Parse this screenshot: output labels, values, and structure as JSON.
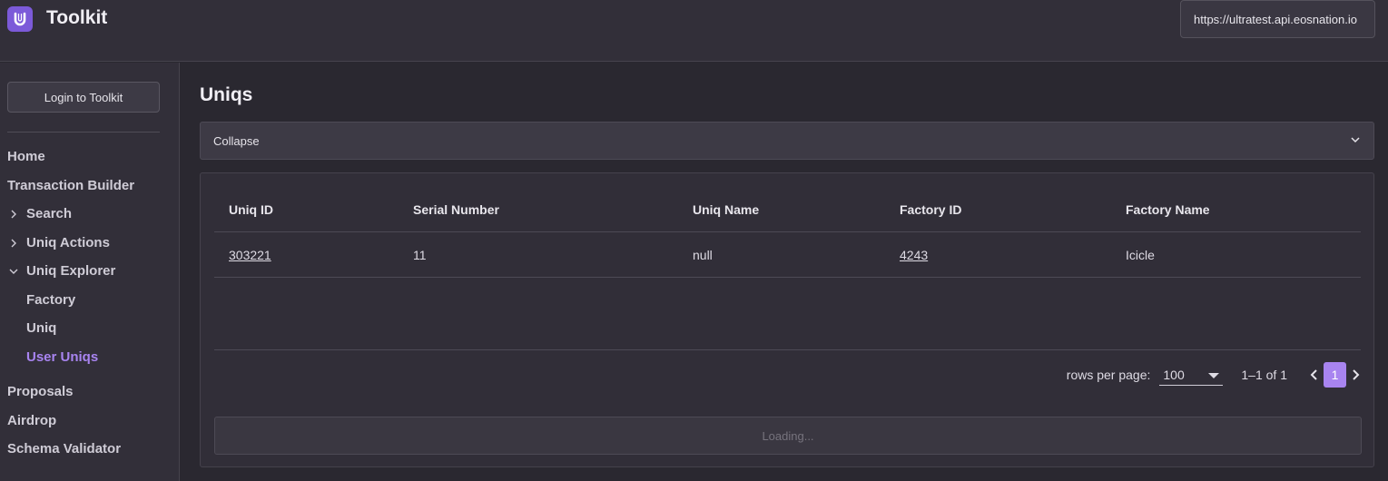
{
  "header": {
    "app_title": "Toolkit",
    "endpoint": "https://ultratest.api.eosnation.io"
  },
  "sidebar": {
    "login_label": "Login to Toolkit",
    "items": [
      {
        "label": "Home"
      },
      {
        "label": "Transaction Builder"
      },
      {
        "label": "Search",
        "expandable": true,
        "expanded": false
      },
      {
        "label": "Uniq Actions",
        "expandable": true,
        "expanded": false
      },
      {
        "label": "Uniq Explorer",
        "expandable": true,
        "expanded": true
      },
      {
        "label": "Factory"
      },
      {
        "label": "Uniq"
      },
      {
        "label": "User Uniqs",
        "active": true
      },
      {
        "label": "Proposals"
      },
      {
        "label": "Airdrop"
      },
      {
        "label": "Schema Validator"
      }
    ]
  },
  "main": {
    "title": "Uniqs",
    "collapse_label": "Collapse",
    "table": {
      "columns": [
        "Uniq ID",
        "Serial Number",
        "Uniq Name",
        "Factory ID",
        "Factory Name"
      ],
      "rows": [
        [
          "303221",
          "11",
          "null",
          "4243",
          "Icicle"
        ]
      ]
    },
    "pagination": {
      "rows_per_page_label": "rows per page:",
      "rows_per_page": "100",
      "range": "1–1 of 1",
      "current_page": "1"
    },
    "loading_label": "Loading..."
  },
  "colors": {
    "accent": "#a884f0",
    "background": "#2a2830",
    "panel": "#322f39"
  }
}
